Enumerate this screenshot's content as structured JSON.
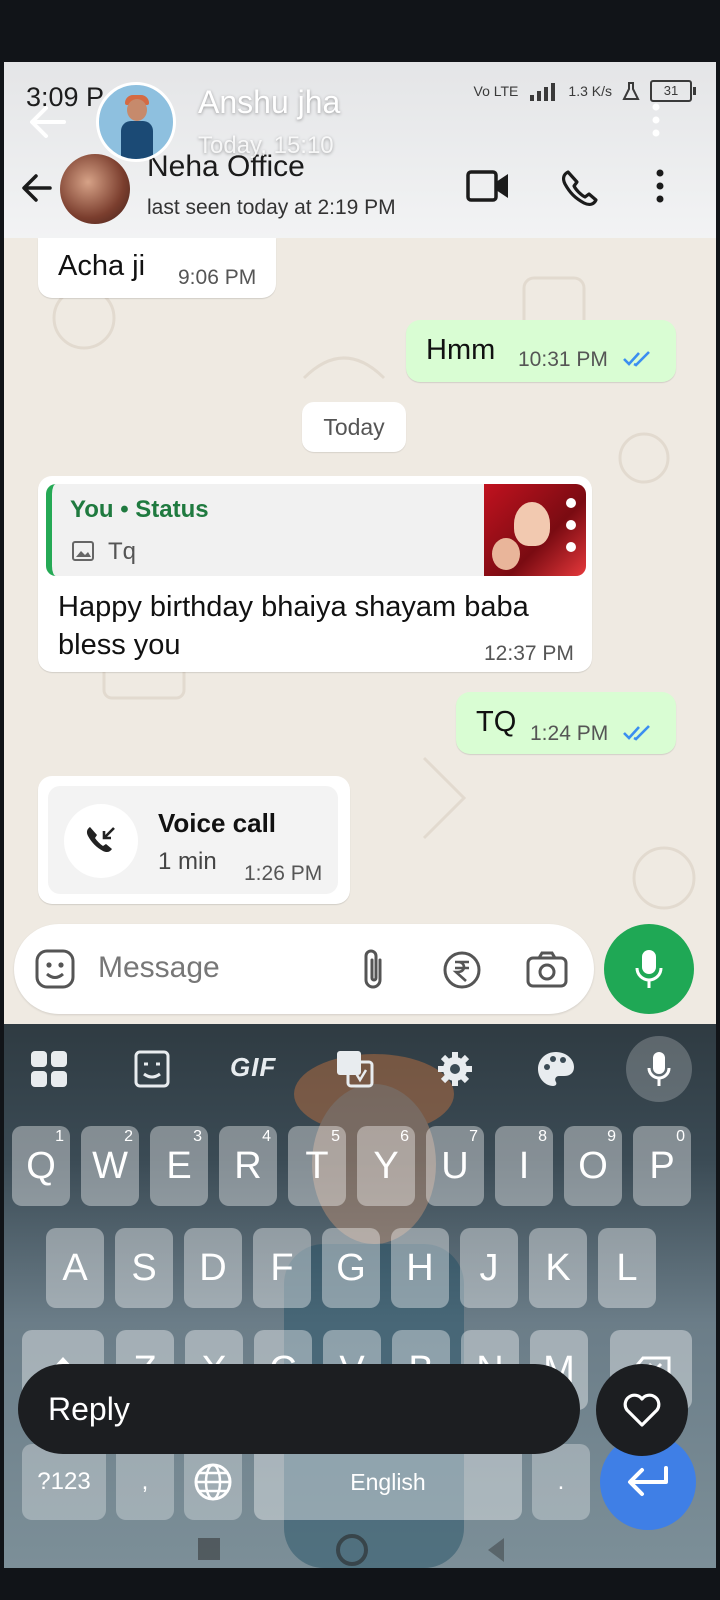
{
  "status_bar": {
    "time": "3:09 P",
    "network": "Vo LTE",
    "speed": "1.3 K/s",
    "battery": "31"
  },
  "story_overlay": {
    "sender_name": "Anshu jha",
    "posted_time": "Today, 15:10"
  },
  "chat_header": {
    "contact_name": "Neha Office",
    "last_seen": "last seen today at 2:19 PM"
  },
  "messages": [
    {
      "direction": "in",
      "text": "Acha ji",
      "time": "9:06 PM"
    },
    {
      "direction": "out",
      "text": "Hmm",
      "time": "10:31 PM",
      "read": true
    },
    {
      "type": "date",
      "text": "Today"
    },
    {
      "direction": "in",
      "reply_to": {
        "sender": "You • Status",
        "caption": "Tq"
      },
      "text": "Happy birthday bhaiya shayam baba bless you",
      "time": "12:37 PM"
    },
    {
      "direction": "out",
      "text": "TQ",
      "time": "1:24 PM",
      "read": true
    },
    {
      "direction": "in",
      "type": "call",
      "title": "Voice call",
      "duration": "1 min",
      "time": "1:26 PM"
    }
  ],
  "composer": {
    "placeholder": "Message"
  },
  "keyboard": {
    "toolbar": {
      "gif_label": "GIF"
    },
    "row1": [
      "Q",
      "W",
      "E",
      "R",
      "T",
      "Y",
      "U",
      "I",
      "O",
      "P"
    ],
    "row1_hints": [
      "1",
      "2",
      "3",
      "4",
      "5",
      "6",
      "7",
      "8",
      "9",
      "0"
    ],
    "row2": [
      "A",
      "S",
      "D",
      "F",
      "G",
      "H",
      "J",
      "K",
      "L"
    ],
    "row3": [
      "Z",
      "X",
      "C",
      "V",
      "B",
      "N",
      "M"
    ],
    "symbols_label": "?123",
    "comma": ",",
    "period": ".",
    "space_label": "English"
  },
  "reply_bar": {
    "label": "Reply"
  },
  "colors": {
    "accent_green": "#1fa855",
    "out_bubble": "#d9fdd3",
    "tick_blue": "#3b8ef0",
    "enter_blue": "#3f7fe6"
  }
}
